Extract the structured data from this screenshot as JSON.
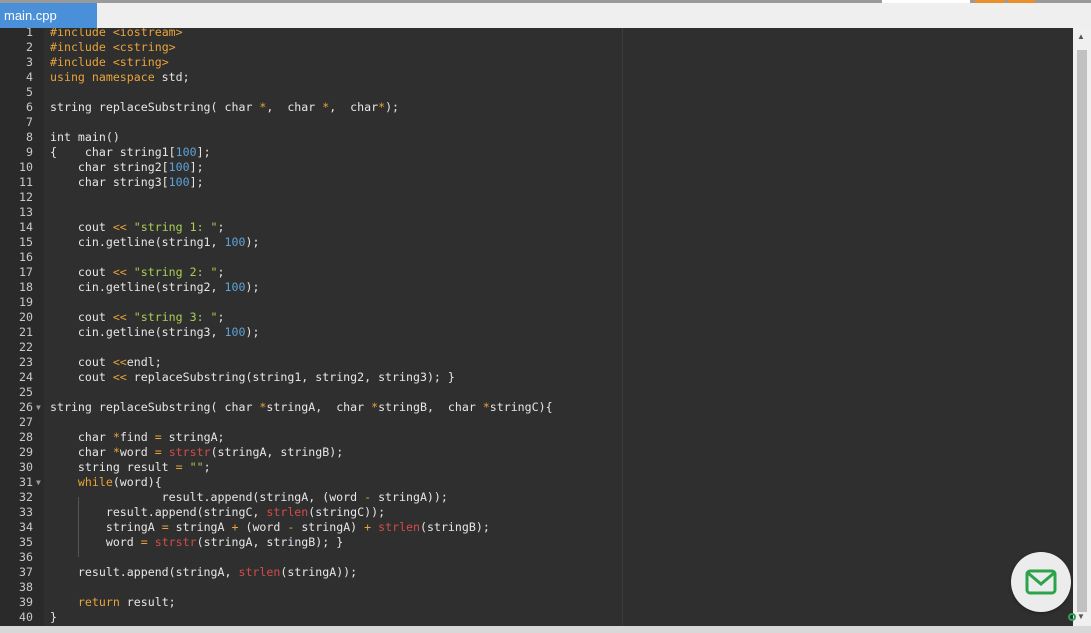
{
  "tab": {
    "label": "main.cpp"
  },
  "editor": {
    "lines": [
      {
        "n": "1",
        "html": "<span class=\"kw\">#include</span> <span class=\"kw\">&lt;iostream&gt;</span>"
      },
      {
        "n": "2",
        "html": "<span class=\"kw\">#include</span> <span class=\"kw\">&lt;cstring&gt;</span>"
      },
      {
        "n": "3",
        "html": "<span class=\"kw\">#include</span> <span class=\"kw\">&lt;string&gt;</span>"
      },
      {
        "n": "4",
        "html": "<span class=\"kw\">using namespace</span> std;"
      },
      {
        "n": "5",
        "html": ""
      },
      {
        "n": "6",
        "html": "string replaceSubstring( char <span class=\"op\">*</span>,  char <span class=\"op\">*</span>,  char<span class=\"op\">*</span>);"
      },
      {
        "n": "7",
        "html": ""
      },
      {
        "n": "8",
        "html": "int main()"
      },
      {
        "n": "9",
        "html": "{    char string1[<span class=\"num\">100</span>];"
      },
      {
        "n": "10",
        "html": "    char string2[<span class=\"num\">100</span>];"
      },
      {
        "n": "11",
        "html": "    char string3[<span class=\"num\">100</span>];"
      },
      {
        "n": "12",
        "html": ""
      },
      {
        "n": "13",
        "html": ""
      },
      {
        "n": "14",
        "html": "    cout <span class=\"op\">&lt;&lt;</span> <span class=\"str\">\"string 1: \"</span>;"
      },
      {
        "n": "15",
        "html": "    cin.getline(string1, <span class=\"num\">100</span>);"
      },
      {
        "n": "16",
        "html": ""
      },
      {
        "n": "17",
        "html": "    cout <span class=\"op\">&lt;&lt;</span> <span class=\"str\">\"string 2: \"</span>;"
      },
      {
        "n": "18",
        "html": "    cin.getline(string2, <span class=\"num\">100</span>);"
      },
      {
        "n": "19",
        "html": ""
      },
      {
        "n": "20",
        "html": "    cout <span class=\"op\">&lt;&lt;</span> <span class=\"str\">\"string 3: \"</span>;"
      },
      {
        "n": "21",
        "html": "    cin.getline(string3, <span class=\"num\">100</span>);"
      },
      {
        "n": "22",
        "html": ""
      },
      {
        "n": "23",
        "html": "    cout <span class=\"op\">&lt;&lt;</span>endl;"
      },
      {
        "n": "24",
        "html": "    cout <span class=\"op\">&lt;&lt;</span> replaceSubstring(string1, string2, string3); }"
      },
      {
        "n": "25",
        "html": ""
      },
      {
        "n": "26",
        "html": "string replaceSubstring( char <span class=\"op\">*</span>stringA,  char <span class=\"op\">*</span>stringB,  char <span class=\"op\">*</span>stringC){",
        "fold": true
      },
      {
        "n": "27",
        "html": ""
      },
      {
        "n": "28",
        "html": "    char <span class=\"op\">*</span>find <span class=\"op\">=</span> stringA;"
      },
      {
        "n": "29",
        "html": "    char <span class=\"op\">*</span>word <span class=\"op\">=</span> <span class=\"fn\">strstr</span>(stringA, stringB);"
      },
      {
        "n": "30",
        "html": "    string result <span class=\"op\">=</span> <span class=\"str\">\"\"</span>;"
      },
      {
        "n": "31",
        "html": "    <span class=\"kw\">while</span>(word){",
        "fold": true
      },
      {
        "n": "32",
        "html": "                result.append(stringA, (word <span class=\"op\">-</span> stringA));"
      },
      {
        "n": "33",
        "html": "        result.append(stringC, <span class=\"fn\">strlen</span>(stringC));"
      },
      {
        "n": "34",
        "html": "        stringA <span class=\"op\">=</span> stringA <span class=\"op\">+</span> (word <span class=\"op\">-</span> stringA) <span class=\"op\">+</span> <span class=\"fn\">strlen</span>(stringB);"
      },
      {
        "n": "35",
        "html": "        word <span class=\"op\">=</span> <span class=\"fn\">strstr</span>(stringA, stringB); }"
      },
      {
        "n": "36",
        "html": ""
      },
      {
        "n": "37",
        "html": "    result.append(stringA, <span class=\"fn\">strlen</span>(stringA));"
      },
      {
        "n": "38",
        "html": ""
      },
      {
        "n": "39",
        "html": "    <span class=\"kw\">return</span> result;"
      },
      {
        "n": "40",
        "html": "}"
      }
    ]
  },
  "icons": {
    "mail": "mail-icon",
    "fold": "fold-arrow-icon",
    "scroll_up": "scroll-up-icon",
    "scroll_down": "scroll-down-icon"
  },
  "colors": {
    "tab": "#4a90d9",
    "editor_bg": "#2f2f2f",
    "keyword": "#e8a33a",
    "number": "#5ea3d9",
    "string": "#a9cf52",
    "builtin": "#d24b4b"
  }
}
